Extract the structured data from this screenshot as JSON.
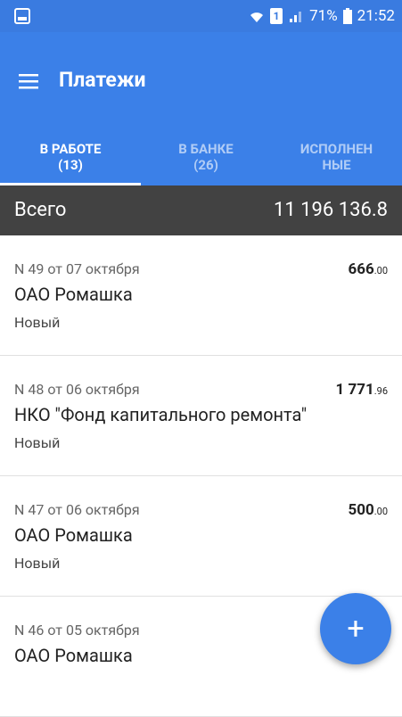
{
  "status_bar": {
    "battery": "71%",
    "time": "21:52",
    "sim_label": "1"
  },
  "app_bar": {
    "title": "Платежи",
    "menu_icon": "menu-icon"
  },
  "tabs": [
    {
      "label": "В РАБОТЕ\n(13)",
      "line1": "В РАБОТЕ",
      "line2": "(13)",
      "active": true
    },
    {
      "label": "В БАНКЕ\n(26)",
      "line1": "В БАНКЕ",
      "line2": "(26)",
      "active": false
    },
    {
      "label": "ИСПОЛНЕН\nНЫЕ",
      "line1": "ИСПОЛНЕН",
      "line2": "НЫЕ",
      "active": false
    }
  ],
  "total": {
    "label": "Всего",
    "value": "11 196 136.8"
  },
  "payments": [
    {
      "meta": "N 49 от 07 октября",
      "amount_int": "666",
      "amount_dec": ".00",
      "name": "ОАО Ромашка",
      "status": "Новый"
    },
    {
      "meta": "N 48 от 06 октября",
      "amount_int": "1 771",
      "amount_dec": ".96",
      "name": "НКО \"Фонд капитального ремонта\"",
      "status": "Новый"
    },
    {
      "meta": "N 47 от 06 октября",
      "amount_int": "500",
      "amount_dec": ".00",
      "name": "ОАО Ромашка",
      "status": "Новый"
    },
    {
      "meta": "N 46 от 05 октября",
      "amount_int": "",
      "amount_dec": "",
      "name": "ОАО Ромашка",
      "status": ""
    }
  ],
  "fab": {
    "label": "+"
  },
  "colors": {
    "primary": "#3b80e8",
    "status_bar": "#3a7be0",
    "total_bar": "#424242"
  }
}
